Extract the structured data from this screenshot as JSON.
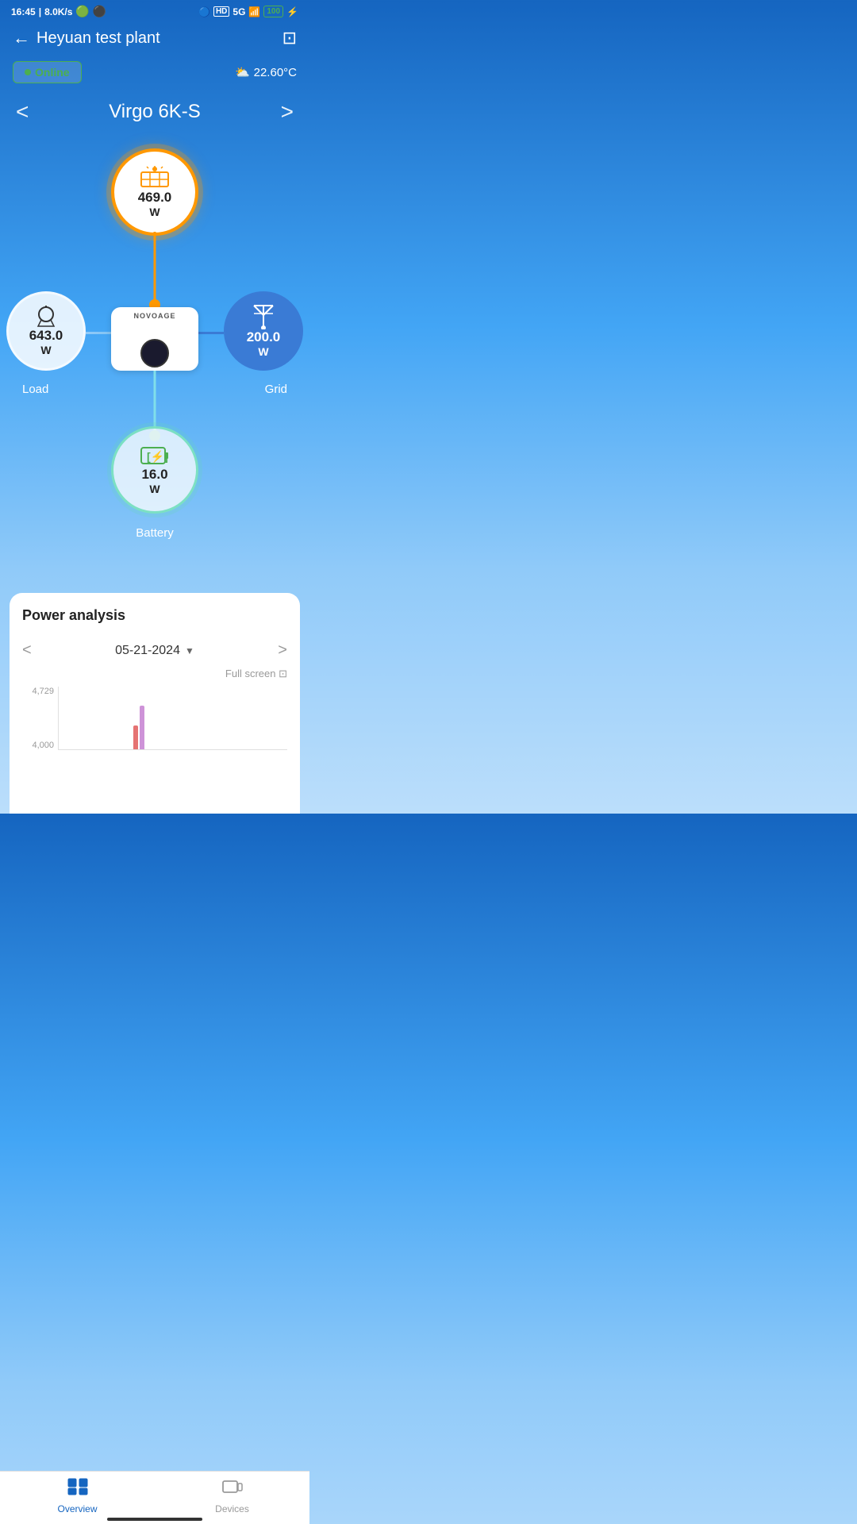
{
  "statusBar": {
    "time": "16:45",
    "speed": "8.0K/s",
    "bluetooth": "⚡",
    "network": "5G",
    "battery": "100"
  },
  "header": {
    "backLabel": "←",
    "title": "Heyuan test plant",
    "expandIcon": "⊡"
  },
  "statusBadge": {
    "label": "Online"
  },
  "weather": {
    "icon": "⛅",
    "temperature": "22.60°C"
  },
  "deviceSelector": {
    "prevArrow": "<",
    "nextArrow": ">",
    "deviceName": "Virgo 6K-S"
  },
  "nodes": {
    "pv": {
      "label": "PV",
      "value": "469.0",
      "unit": "W",
      "icon": "☀"
    },
    "load": {
      "label": "Load",
      "value": "643.0",
      "unit": "W",
      "icon": "💡"
    },
    "grid": {
      "label": "Grid",
      "value": "200.0",
      "unit": "W",
      "icon": "🗼"
    },
    "battery": {
      "label": "Battery",
      "value": "16.0",
      "unit": "W",
      "icon": "[⚡]"
    }
  },
  "inverter": {
    "brand": "NOVOAGE"
  },
  "powerAnalysis": {
    "title": "Power analysis",
    "date": "05-21-2024",
    "fullscreenLabel": "Full screen ⊡",
    "prevArrow": "<",
    "nextArrow": ">",
    "yLabels": [
      "4,729",
      "4,000"
    ],
    "chart": {
      "bars": [
        {
          "color": "#e57373",
          "height": 30
        },
        {
          "color": "#ce93d8",
          "height": 55
        }
      ]
    }
  },
  "bottomNav": {
    "items": [
      {
        "label": "Overview",
        "icon": "overview",
        "active": true
      },
      {
        "label": "Devices",
        "icon": "devices",
        "active": false
      }
    ]
  }
}
